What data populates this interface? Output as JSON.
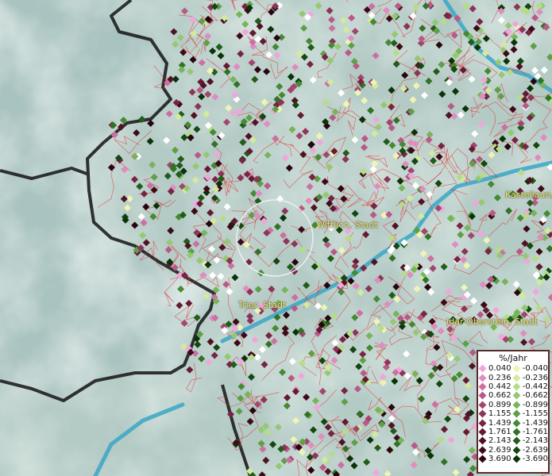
{
  "map": {
    "cities": [
      {
        "name": "Wittlich, Stadt"
      },
      {
        "name": "Trier, Stadt"
      },
      {
        "name": "Idar-Oberstein, Stadt"
      },
      {
        "name": "Kastellaun, S"
      }
    ]
  },
  "legend": {
    "title": "%/Jahr",
    "rows": [
      {
        "pos": "0.040",
        "neg": "-0.040",
        "pos_color": "#f0a6dc",
        "neg_color": "#eef5b4"
      },
      {
        "pos": "0.236",
        "neg": "-0.236",
        "pos_color": "#e08cc0",
        "neg_color": "#d2ea9c"
      },
      {
        "pos": "0.442",
        "neg": "-0.442",
        "pos_color": "#cc70a2",
        "neg_color": "#b6dc88"
      },
      {
        "pos": "0.662",
        "neg": "-0.662",
        "pos_color": "#b85a88",
        "neg_color": "#96c872"
      },
      {
        "pos": "0.899",
        "neg": "-0.899",
        "pos_color": "#a2466e",
        "neg_color": "#78b45a"
      },
      {
        "pos": "1.155",
        "neg": "-1.155",
        "pos_color": "#8e3458",
        "neg_color": "#5ea046"
      },
      {
        "pos": "1.439",
        "neg": "-1.439",
        "pos_color": "#7a2444",
        "neg_color": "#468a34"
      },
      {
        "pos": "1.761",
        "neg": "-1.761",
        "pos_color": "#661a32",
        "neg_color": "#327226"
      },
      {
        "pos": "2.143",
        "neg": "-2.143",
        "pos_color": "#521224",
        "neg_color": "#225c1a"
      },
      {
        "pos": "2.639",
        "neg": "-2.639",
        "pos_color": "#3e0a18",
        "neg_color": "#144810"
      },
      {
        "pos": "3.690",
        "neg": "-3.690",
        "pos_color": "#2a040e",
        "neg_color": "#0a3408"
      }
    ]
  }
}
